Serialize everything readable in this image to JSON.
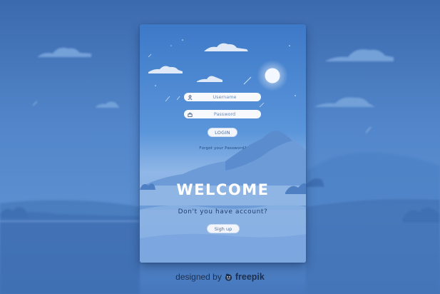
{
  "login": {
    "username_placeholder": "Username",
    "password_placeholder": "Password",
    "login_label": "LOGIN",
    "forgot_label": "Forgot your Password?",
    "welcome_title": "WELCOME",
    "account_prompt": "Don't you have account?",
    "signup_label": "Sigh up"
  },
  "credit": {
    "designed_by": "designed by",
    "brand": "freepik"
  },
  "icons": {
    "username": "user-icon",
    "password": "lock-icon",
    "moon": "moon-icon",
    "brand_logo": "freepik-logo-icon"
  },
  "colors": {
    "background": "#4f82c6",
    "card_top": "#3e79c8",
    "card_mid": "#8fb6e6",
    "welcome_text": "#ffffff",
    "field_fill": "#f7f9fd"
  }
}
